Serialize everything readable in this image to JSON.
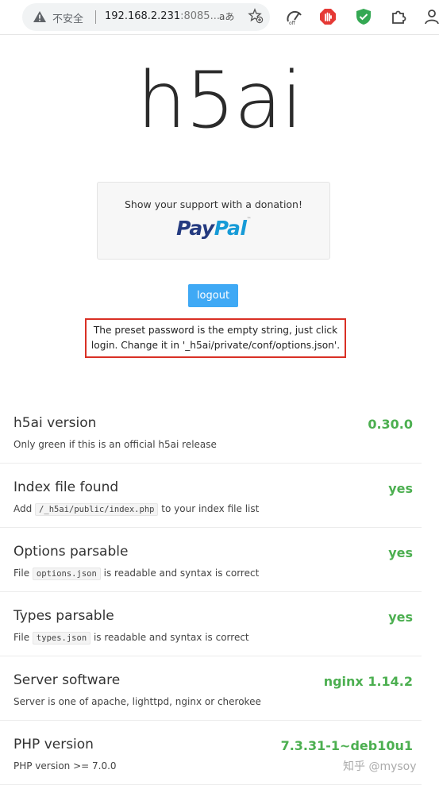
{
  "browser": {
    "security_label": "不安全",
    "url_host": "192.168.2.231",
    "url_rest": ":8085...",
    "translate_label": "aあ"
  },
  "page": {
    "logo": "h5ai",
    "donation_text": "Show your support with a donation!",
    "paypal_pay": "Pay",
    "paypal_pal": "Pal",
    "paypal_tm": "™",
    "logout_label": "logout",
    "hint_line1": "The preset password is the empty string, just click",
    "hint_line2": "login. Change it in '_h5ai/private/conf/options.json'."
  },
  "tests": [
    {
      "label": "h5ai version",
      "result": "0.30.0",
      "info_pre": "Only green if this is an official h5ai release",
      "code": "",
      "info_post": ""
    },
    {
      "label": "Index file found",
      "result": "yes",
      "info_pre": "Add",
      "code": "/_h5ai/public/index.php",
      "info_post": "to your index file list"
    },
    {
      "label": "Options parsable",
      "result": "yes",
      "info_pre": "File",
      "code": "options.json",
      "info_post": "is readable and syntax is correct"
    },
    {
      "label": "Types parsable",
      "result": "yes",
      "info_pre": "File",
      "code": "types.json",
      "info_post": "is readable and syntax is correct"
    },
    {
      "label": "Server software",
      "result": "nginx 1.14.2",
      "info_pre": "Server is one of apache, lighttpd, nginx or cherokee",
      "code": "",
      "info_post": ""
    },
    {
      "label": "PHP version",
      "result": "7.3.31-1~deb10u1",
      "info_pre": "PHP version >= 7.0.0",
      "code": "",
      "info_post": ""
    }
  ],
  "watermark": "知乎 @mysoy",
  "colors": {
    "accent": "#3fa9f5",
    "success": "#4caf50",
    "highlight": "#d93025"
  }
}
